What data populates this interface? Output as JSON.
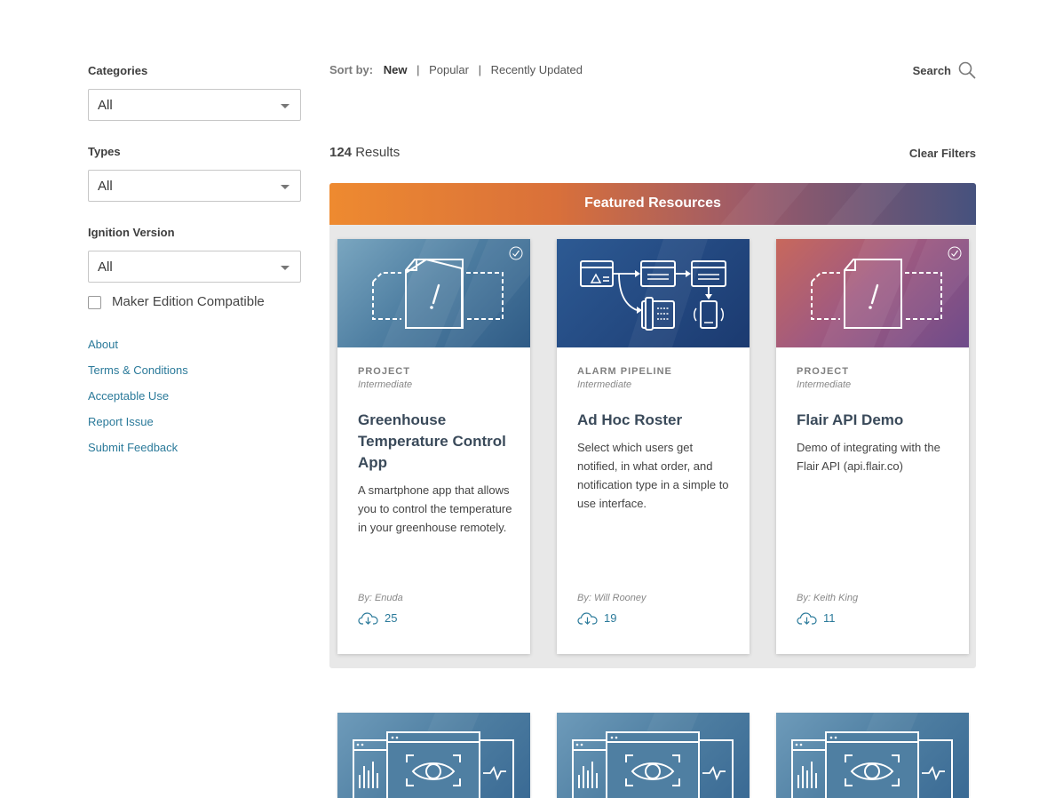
{
  "filters": {
    "categories": {
      "label": "Categories",
      "value": "All"
    },
    "types": {
      "label": "Types",
      "value": "All"
    },
    "ignition_version": {
      "label": "Ignition Version",
      "value": "All"
    },
    "maker_edition": {
      "label": "Maker Edition Compatible",
      "checked": false
    }
  },
  "side_links": [
    "About",
    "Terms & Conditions",
    "Acceptable Use",
    "Report Issue",
    "Submit Feedback"
  ],
  "sort": {
    "label": "Sort by:",
    "options": [
      "New",
      "Popular",
      "Recently Updated"
    ],
    "active": "New"
  },
  "search_label": "Search",
  "results": {
    "count": "124",
    "label": "Results"
  },
  "clear_filters": "Clear Filters",
  "featured": {
    "title": "Featured Resources",
    "cards": [
      {
        "type": "PROJECT",
        "level": "Intermediate",
        "title": "Greenhouse Temperature Control App",
        "description": "A smartphone app that allows you to control the temperature in your greenhouse remotely.",
        "author": "By: Enuda",
        "downloads": "25",
        "verified": true
      },
      {
        "type": "ALARM PIPELINE",
        "level": "Intermediate",
        "title": "Ad Hoc Roster",
        "description": "Select which users get notified, in what order, and notification type in a simple to use interface.",
        "author": "By: Will Rooney",
        "downloads": "19",
        "verified": false
      },
      {
        "type": "PROJECT",
        "level": "Intermediate",
        "title": "Flair API Demo",
        "description": "Demo of integrating with the Flair API (api.flair.co)",
        "author": "By: Keith King",
        "downloads": "11",
        "verified": true
      }
    ]
  },
  "colors": {
    "link": "#2b7a9a",
    "featured_start": "#ee8a30",
    "featured_end": "#46527e"
  }
}
